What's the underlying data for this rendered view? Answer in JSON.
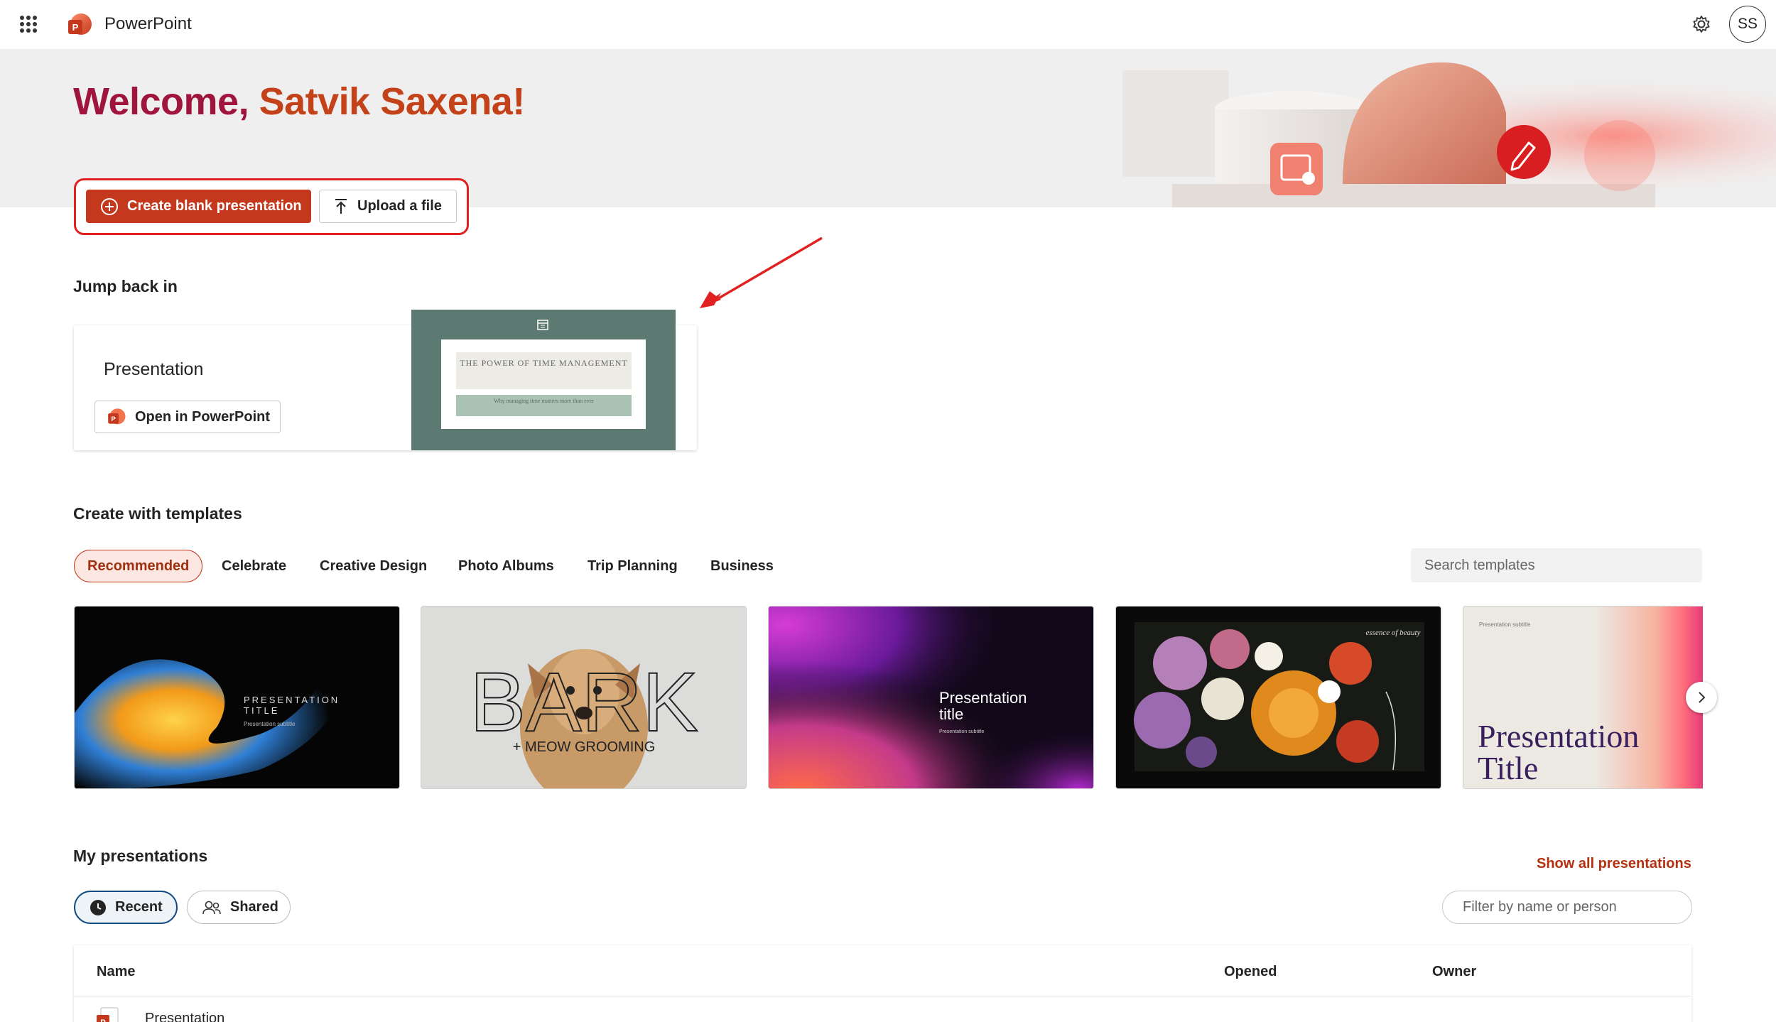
{
  "app": {
    "name": "PowerPoint",
    "user_initials": "SS"
  },
  "welcome": {
    "greeting": "Welcome, ",
    "user_name": "Satvik Saxena!"
  },
  "actions": {
    "create_label": "Create blank presentation",
    "upload_label": "Upload a file"
  },
  "jump_back": {
    "title": "Jump back in",
    "card_title": "Presentation",
    "open_label": "Open in PowerPoint",
    "thumb_title": "THE POWER OF TIME MANAGEMENT",
    "thumb_subtitle": "Why managing time matters more than ever"
  },
  "templates": {
    "title": "Create with templates",
    "tabs": [
      "Recommended",
      "Celebrate",
      "Creative Design",
      "Photo Albums",
      "Trip Planning",
      "Business"
    ],
    "active_tab": "Recommended",
    "search_placeholder": "Search templates",
    "cards": [
      {
        "title": "PRESENTATION TITLE",
        "subtitle": "Presentation subtitle"
      },
      {
        "title": "BARK",
        "subtitle": "+ MEOW GROOMING"
      },
      {
        "title": "Presentation title",
        "subtitle": "Presentation subtitle"
      },
      {
        "title": "essence of beauty"
      },
      {
        "title": "Presentation Title",
        "subtitle": "Presentation subtitle"
      }
    ]
  },
  "my_presentations": {
    "title": "My presentations",
    "show_all_label": "Show all presentations",
    "filters": {
      "recent_label": "Recent",
      "shared_label": "Shared"
    },
    "filter_placeholder": "Filter by name or person",
    "columns": {
      "name": "Name",
      "opened": "Opened",
      "owner": "Owner"
    },
    "rows": [
      {
        "name": "Presentation"
      }
    ]
  },
  "colors": {
    "accent": "#c4391d",
    "welcome_1": "#a0153e",
    "welcome_2": "#c4421a",
    "link": "#b5300e",
    "highlight_box": "#e0211f"
  }
}
